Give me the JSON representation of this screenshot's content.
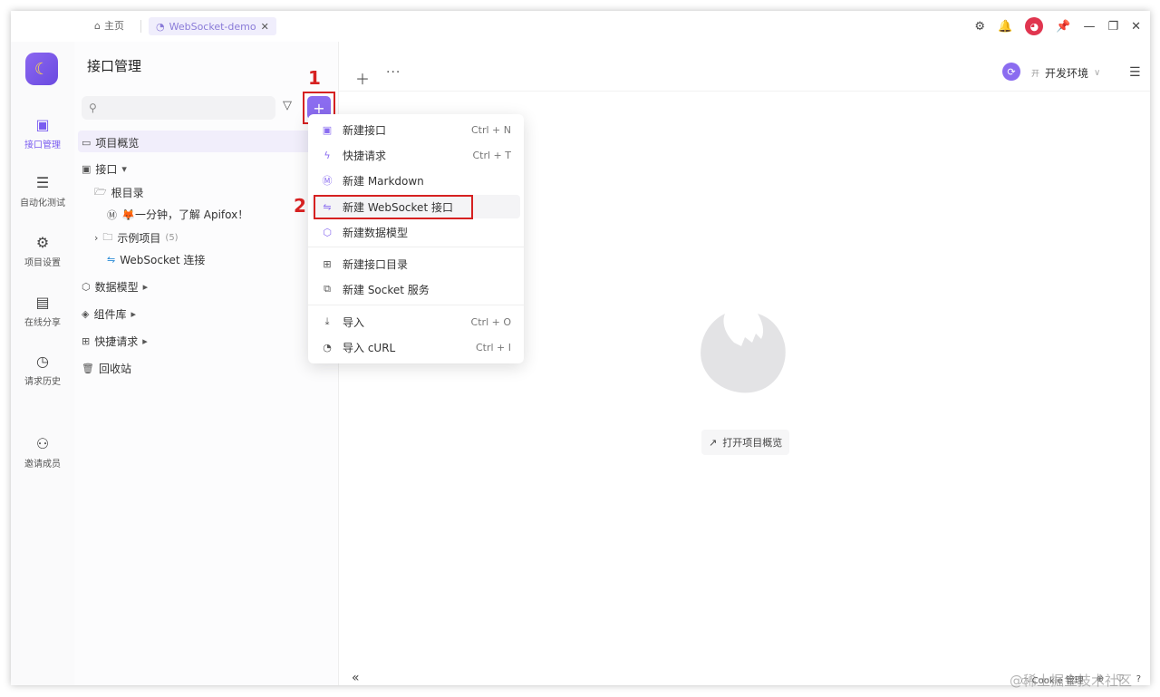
{
  "titlebar": {
    "home_label": "主页",
    "active_tab": "WebSocket-demo",
    "close_glyph": "✕",
    "icons": [
      "gear-icon",
      "bell-icon",
      "avatar",
      "pin-icon",
      "minimize-icon",
      "restore-icon",
      "close-icon"
    ]
  },
  "rail": {
    "items": [
      {
        "label": "接口管理",
        "icon": "api-icon",
        "active": true
      },
      {
        "label": "自动化测试",
        "icon": "list-icon"
      },
      {
        "label": "项目设置",
        "icon": "settings-icon"
      },
      {
        "label": "在线分享",
        "icon": "share-doc-icon"
      },
      {
        "label": "请求历史",
        "icon": "history-icon"
      },
      {
        "label": "邀请成员",
        "icon": "invite-user-icon"
      }
    ]
  },
  "panel": {
    "title": "接口管理",
    "add_label": "+",
    "annotation_1": "1",
    "tree": {
      "overview": "项目概览",
      "api_section": "接口",
      "root_folder": "根目录",
      "doc_item": "🦊一分钟，了解 Apifox！",
      "example_folder": "示例项目",
      "example_count": "(5)",
      "ws_item": "WebSocket 连接",
      "data_models": "数据模型",
      "components": "组件库",
      "quick_requests": "快捷请求",
      "recycle_bin": "回收站"
    }
  },
  "main": {
    "env_badge": "开",
    "env_label": "开发环境",
    "open_overview": "打开项目概览",
    "cookie_label": "Cookie 管理"
  },
  "dropdown": {
    "annotation_2": "2",
    "items": [
      {
        "label": "新建接口",
        "shortcut": "Ctrl + N"
      },
      {
        "label": "快捷请求",
        "shortcut": "Ctrl + T"
      },
      {
        "label": "新建 Markdown",
        "shortcut": ""
      },
      {
        "label": "新建 WebSocket 接口",
        "shortcut": ""
      },
      {
        "label": "新建数据模型",
        "shortcut": ""
      },
      {
        "label": "新建接口目录",
        "shortcut": ""
      },
      {
        "label": "新建 Socket 服务",
        "shortcut": ""
      },
      {
        "label": "导入",
        "shortcut": "Ctrl + O"
      },
      {
        "label": "导入 cURL",
        "shortcut": "Ctrl + I"
      }
    ]
  },
  "watermark": "@稀土掘金技术社区",
  "colors": {
    "accent": "#8b6cf0",
    "annotation": "#d62121"
  }
}
